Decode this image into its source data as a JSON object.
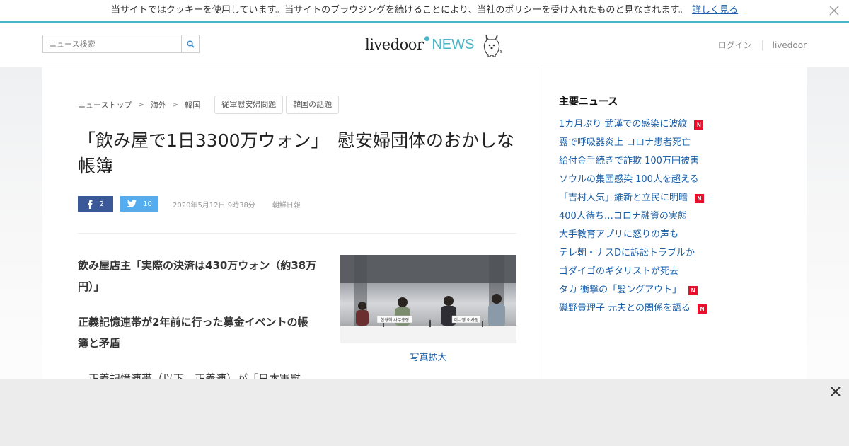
{
  "cookie_bar": {
    "message": "当サイトではクッキーを使用しています。当サイトのブラウジングを続けることにより、当社のポリシーを受け入れたものと見なされます。",
    "link_label": "詳しく見る"
  },
  "header": {
    "search_placeholder": "ニュース検索",
    "logo_brand": "livedoor",
    "logo_news": "NEWS",
    "login_label": "ログイン",
    "livedoor_label": "livedoor"
  },
  "breadcrumb": {
    "items": [
      "ニューストップ",
      "海外",
      "韓国"
    ],
    "tags": [
      "従軍慰安婦問題",
      "韓国の話題"
    ]
  },
  "article": {
    "title": "「飲み屋で1日3300万ウォン」　慰安婦団体のおかしな帳簿",
    "facebook_count": "2",
    "twitter_count": "10",
    "date": "2020年5月12日 9時38分",
    "source": "朝鮮日報",
    "lead1": "飲み屋店主「実際の決済は430万ウォン（約38万円）」",
    "lead2": "正義記憶連帯が2年前に行った募金イベントの帳簿と矛盾",
    "body": "正義記憶連帯（以下、正義連）が「日本軍慰",
    "photo_caption": "写真拡大",
    "photo_placard_1": "한경희 사무총장",
    "photo_placard_2": "이나영 이사장"
  },
  "sidebar": {
    "title": "主要ニュース",
    "news": [
      {
        "text": "1カ月ぶり 武漢での感染に波紋",
        "badge": "N"
      },
      {
        "text": "露で呼吸器炎上 コロナ患者死亡",
        "badge": ""
      },
      {
        "text": "給付金手続きで詐欺 100万円被害",
        "badge": ""
      },
      {
        "text": "ソウルの集団感染 100人を超える",
        "badge": ""
      },
      {
        "text": "「吉村人気」維新と立民に明暗",
        "badge": "N"
      },
      {
        "text": "400人待ち…コロナ融資の実態",
        "badge": ""
      },
      {
        "text": "大手教育アプリに怒りの声も",
        "badge": ""
      },
      {
        "text": "テレ朝・ナスDに訴訟トラブルか",
        "badge": ""
      },
      {
        "text": "ゴダイゴのギタリストが死去",
        "badge": ""
      },
      {
        "text": "タカ 衝撃の「髪ングアウト」",
        "badge": "N"
      },
      {
        "text": "磯野貴理子 元夫との関係を語る",
        "badge": "N"
      }
    ]
  },
  "colors": {
    "accent": "#48b6c8",
    "link": "#1a5fa8",
    "facebook": "#3b5998",
    "twitter": "#55acee",
    "badge": "#e8112d"
  }
}
